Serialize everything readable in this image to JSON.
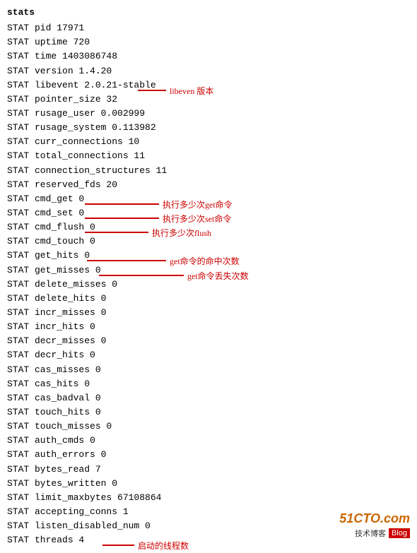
{
  "title": "stats",
  "lines": [
    "STAT pid 17971",
    "STAT uptime 720",
    "STAT time 1403086748",
    "STAT version 1.4.20",
    "STAT libevent 2.0.21-stable",
    "STAT pointer_size 32",
    "STAT rusage_user 0.002999",
    "STAT rusage_system 0.113982",
    "STAT curr_connections 10",
    "STAT total_connections 11",
    "STAT connection_structures 11",
    "STAT reserved_fds 20",
    "STAT cmd_get 0",
    "STAT cmd_set 0",
    "STAT cmd_flush 0",
    "STAT cmd_touch 0",
    "STAT get_hits 0",
    "STAT get_misses 0",
    "STAT delete_misses 0",
    "STAT delete_hits 0",
    "STAT incr_misses 0",
    "STAT incr_hits 0",
    "STAT decr_misses 0",
    "STAT decr_hits 0",
    "STAT cas_misses 0",
    "STAT cas_hits 0",
    "STAT cas_badval 0",
    "STAT touch_hits 0",
    "STAT touch_misses 0",
    "STAT auth_cmds 0",
    "STAT auth_errors 0",
    "STAT bytes_read 7",
    "STAT bytes_written 0",
    "STAT limit_maxbytes 67108864",
    "STAT accepting_conns 1",
    "STAT listen_disabled_num 0",
    "STAT threads 4"
  ],
  "annotations": [
    {
      "id": "libevent",
      "text": "libeven 版本",
      "arrow": true
    },
    {
      "id": "cmd_get",
      "text": "执行多少次get命令",
      "arrow": true
    },
    {
      "id": "cmd_set",
      "text": "执行多少次set命令",
      "arrow": true
    },
    {
      "id": "cmd_flush",
      "text": "执行多少次flush",
      "arrow": true
    },
    {
      "id": "get_hits",
      "text": "get命令的命中次数",
      "arrow": true
    },
    {
      "id": "get_misses",
      "text": "get命令丢失次数",
      "arrow": true
    },
    {
      "id": "threads",
      "text": "启动的线程数",
      "arrow": true
    }
  ],
  "watermark": {
    "site": "51CTO.com",
    "tech": "技术博客",
    "blog": "Blog"
  }
}
